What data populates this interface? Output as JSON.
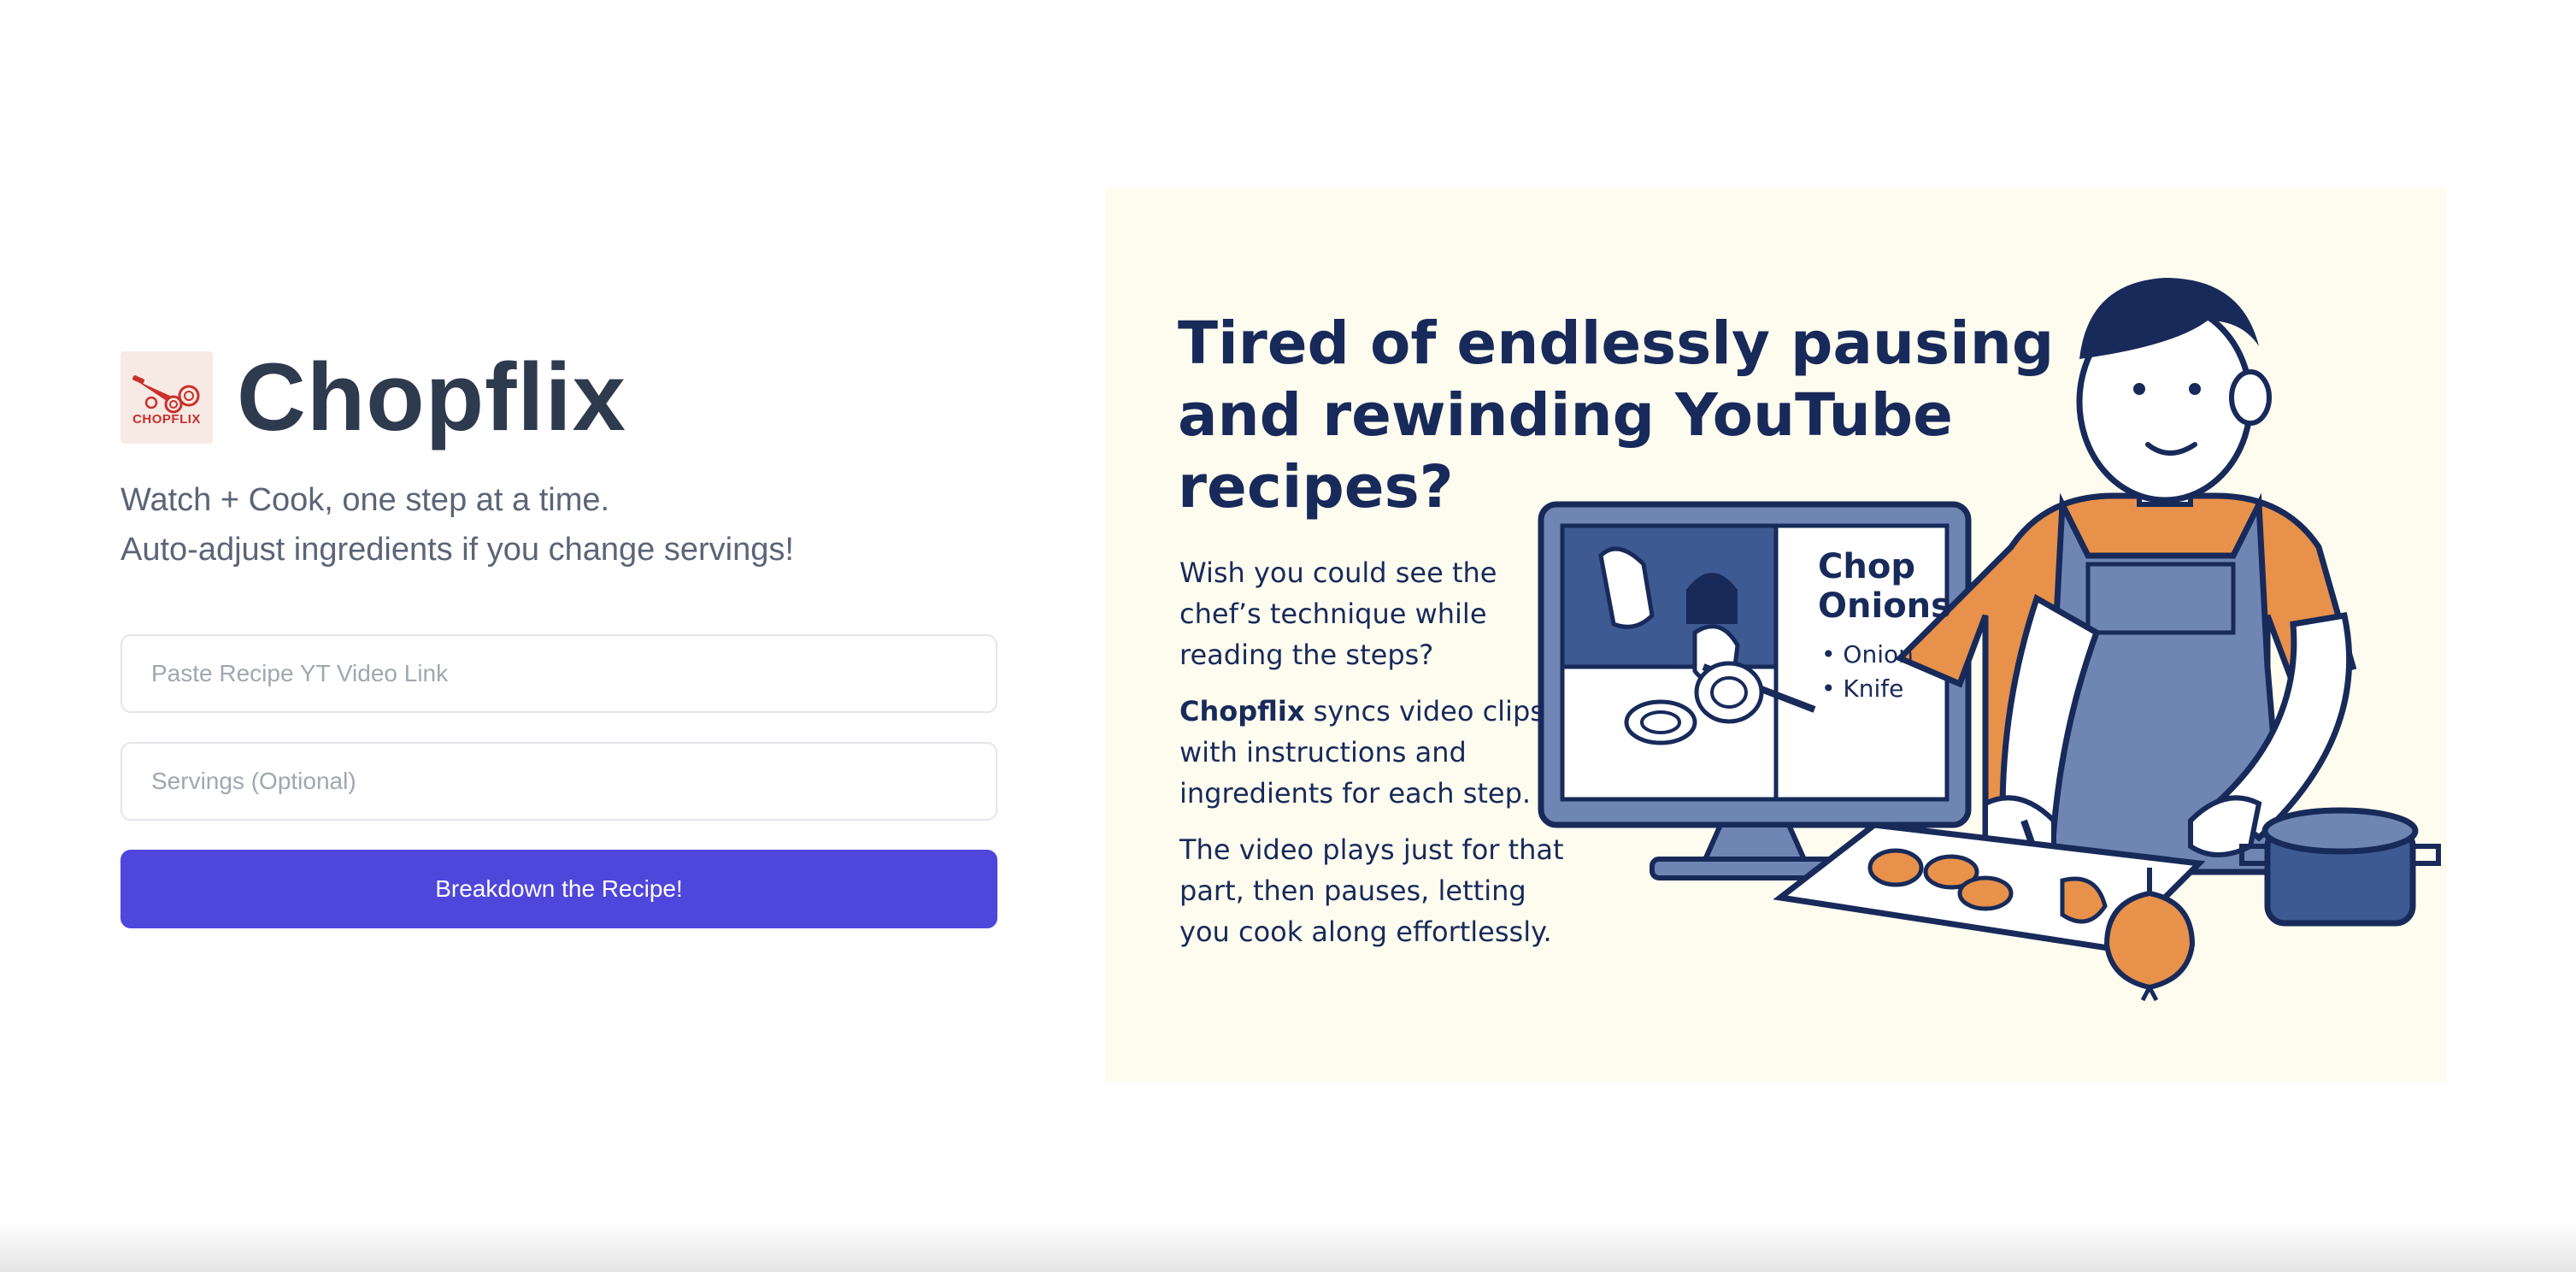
{
  "brand": {
    "logo_text": "CHOPFLIX",
    "name": "Chopflix"
  },
  "tagline": {
    "line1": "Watch + Cook, one step at a time.",
    "line2": "Auto-adjust ingredients if you change servings!"
  },
  "form": {
    "video_link_placeholder": "Paste Recipe YT Video Link",
    "video_link_value": "",
    "servings_placeholder": "Servings (Optional)",
    "servings_value": "",
    "submit_label": "Breakdown the Recipe!"
  },
  "illustration": {
    "heading_line1": "Tired of endlessly pausing",
    "heading_line2": "and rewinding YouTube",
    "heading_line3": "recipes?",
    "para1_line1": "Wish you could see the",
    "para1_line2": "chef’s technique while",
    "para1_line3": "reading the steps?",
    "para2_brand": "Chopflix",
    "para2_line1_rest": " syncs video clips",
    "para2_line2": "with instructions and",
    "para2_line3": "ingredients for each step.",
    "para3_line1": "The video plays just for that",
    "para3_line2": "part, then pauses, letting",
    "para3_line3": "you cook along effortlessly.",
    "screen_title_line1": "Chop",
    "screen_title_line2": "Onions",
    "screen_item1": "• Onion",
    "screen_item2": "• Knife"
  },
  "colors": {
    "brand_text": "#2e3a4e",
    "button": "#4f46dc",
    "panel_bg": "#fefcef",
    "illustration_navy": "#172a5a",
    "illustration_orange": "#e8914a",
    "illustration_apron": "#6f86b5"
  }
}
